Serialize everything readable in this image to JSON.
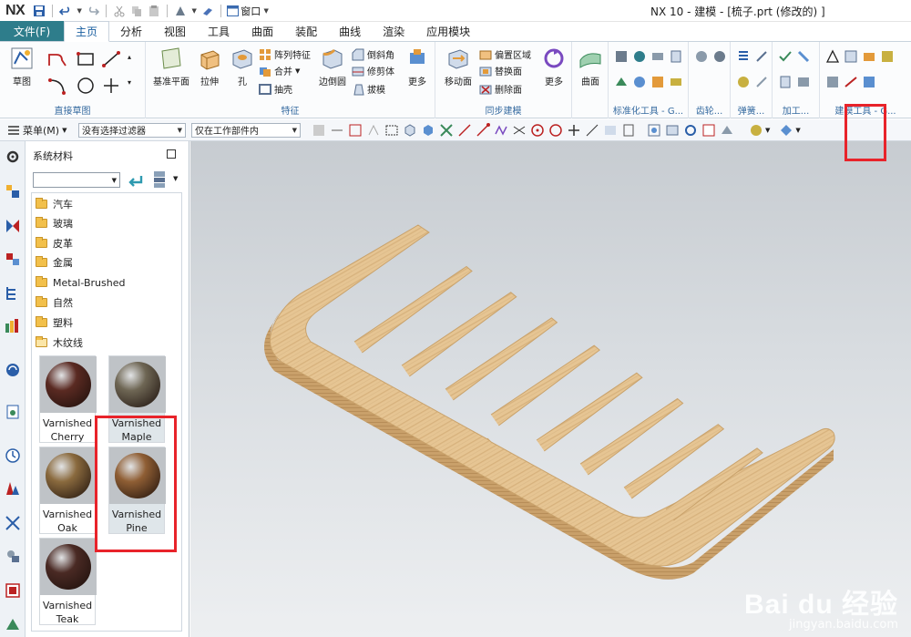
{
  "titlebar": {
    "logo": "NX",
    "window_menu": "窗口",
    "title": "NX 10 - 建模 - [梳子.prt  (修改的) ]"
  },
  "tabs": [
    "文件(F)",
    "主页",
    "分析",
    "视图",
    "工具",
    "曲面",
    "装配",
    "曲线",
    "渲染",
    "应用模块"
  ],
  "active_tab": "主页",
  "ribbon": {
    "sketch_group": {
      "label": "直接草图",
      "sketch_btn": "草图"
    },
    "feature_group": {
      "label": "特征",
      "datum_plane": "基准平面",
      "extrude": "拉伸",
      "hole": "孔",
      "pattern": "阵列特征",
      "unite": "合并",
      "shell": "抽壳",
      "edge_blend": "边倒圆",
      "chamfer": "倒斜角",
      "trim_body": "修剪体",
      "draft": "拔模",
      "more": "更多"
    },
    "sync_group": {
      "label": "同步建模",
      "move_face": "移动面",
      "offset_region": "偏置区域",
      "replace_face": "替换面",
      "delete_face": "删除面",
      "more": "更多"
    },
    "surface_group": {
      "label": "曲面",
      "more": "曲面"
    },
    "std_tools_label": "标准化工具 - G...",
    "gear_label": "齿轮...",
    "spring_label": "弹簧...",
    "machining_label": "加工...",
    "modeling_tools_label": "建模工具 - G..."
  },
  "selection_bar": {
    "menu": "菜单(M)",
    "filter": "没有选择过滤器",
    "scope": "仅在工作部件内"
  },
  "panel": {
    "title": "系统材料",
    "folders": [
      "汽车",
      "玻璃",
      "皮革",
      "金属",
      "Metal-Brushed",
      "自然",
      "塑料",
      "木纹线"
    ],
    "materials": [
      {
        "line1": "Varnished",
        "line2": "Cherry",
        "color": "#5a2a22"
      },
      {
        "line1": "Varnished",
        "line2": "Maple",
        "color": "#6e6654"
      },
      {
        "line1": "Varnished",
        "line2": "Oak",
        "color": "#8a6a3e"
      },
      {
        "line1": "Varnished",
        "line2": "Pine",
        "color": "#8f5e34"
      },
      {
        "line1": "Varnished",
        "line2": "Teak",
        "color": "#4a2a24"
      }
    ],
    "selected": "Varnished Pine"
  },
  "colors": {
    "file_tab": "#2e7d8b",
    "highlight": "#e8232a",
    "comb_wood": "#e8c898",
    "comb_edge": "#c39d67"
  },
  "watermark": {
    "brand": "Bai du 经验",
    "url": "jingyan.baidu.com"
  }
}
